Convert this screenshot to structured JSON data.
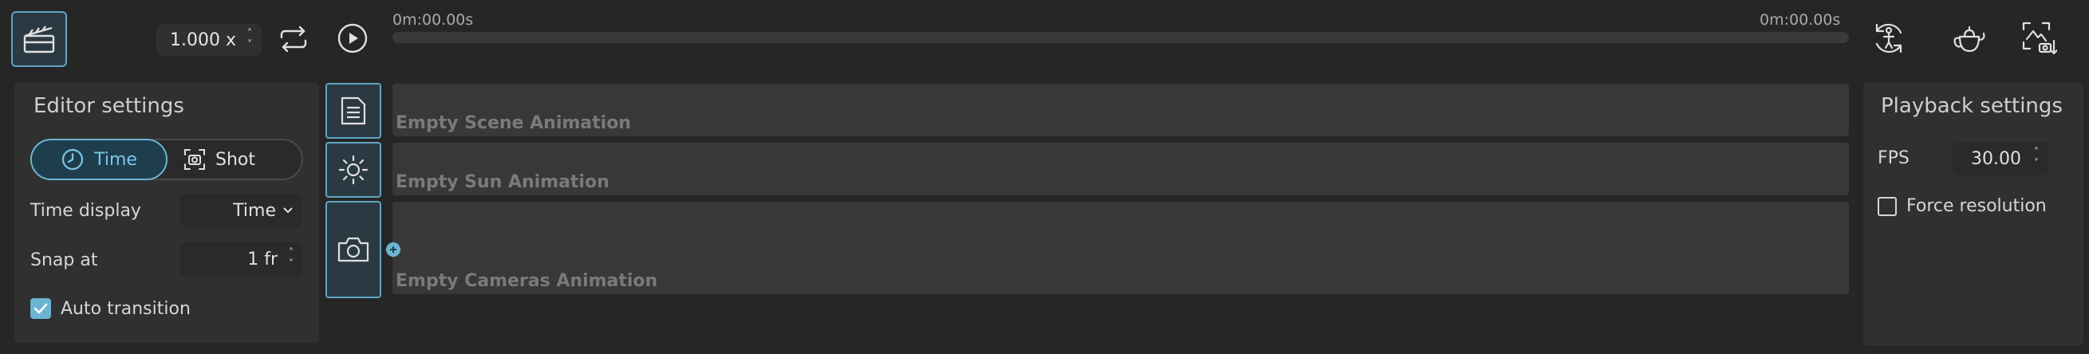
{
  "toolbar": {
    "speed_value": "1.000 x",
    "time_start": "0m:00.00s",
    "time_end": "0m:00.00s",
    "icons": [
      "clapperboard-icon",
      "loop-icon",
      "play-icon",
      "rotate-person-icon",
      "teapot-icon",
      "image-export-icon"
    ]
  },
  "editor_settings": {
    "title": "Editor settings",
    "mode_time_label": "Time",
    "mode_shot_label": "Shot",
    "time_display_label": "Time display",
    "time_display_value": "Time",
    "snap_label": "Snap at",
    "snap_value": "1 fr",
    "auto_transition_label": "Auto transition",
    "auto_transition_checked": true
  },
  "tracks": [
    {
      "label": "Empty Scene Animation",
      "icon": "document-icon"
    },
    {
      "label": "Empty Sun Animation",
      "icon": "sun-icon"
    },
    {
      "label": "Empty Cameras Animation",
      "icon": "camera-icon"
    }
  ],
  "playback_settings": {
    "title": "Playback settings",
    "fps_label": "FPS",
    "fps_value": "30.00",
    "force_resolution_label": "Force resolution",
    "force_resolution_checked": false
  },
  "colors": {
    "accent": "#6cb4d2",
    "background": "#262626",
    "panel": "#303030",
    "track": "#383838"
  }
}
